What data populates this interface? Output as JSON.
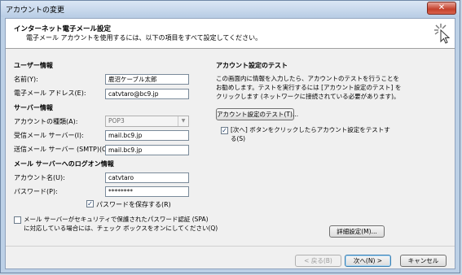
{
  "window": {
    "title": "アカウントの変更",
    "close_label": "✕"
  },
  "header": {
    "title": "インターネット電子メール設定",
    "subtitle": "電子メール アカウントを使用するには、以下の項目をすべて設定してください。"
  },
  "user_info": {
    "section": "ユーザー情報",
    "name_label": "名前(Y):",
    "name_value": "鹿沼ケーブル太郎",
    "email_label": "電子メール アドレス(E):",
    "email_value": "catvtaro@bc9.jp"
  },
  "server_info": {
    "section": "サーバー情報",
    "type_label": "アカウントの種類(A):",
    "type_value": "POP3",
    "incoming_label": "受信メール サーバー(I):",
    "incoming_value": "mail.bc9.jp",
    "outgoing_label": "送信メール サーバー (SMTP)(O):",
    "outgoing_value": "mail.bc9.jp"
  },
  "login_info": {
    "section": "メール サーバーへのログオン情報",
    "account_label": "アカウント名(U):",
    "account_value": "catvtaro",
    "password_label": "パスワード(P):",
    "password_value": "********",
    "remember_label": "パスワードを保存する(R)",
    "spa_line1": "メール サーバーがセキュリティで保護されたパスワード認証 (SPA)",
    "spa_line2": "に対応している場合には、チェック ボックスをオンにしてください(Q)"
  },
  "test": {
    "section": "アカウント設定のテスト",
    "desc1": "この画面内に情報を入力したら、アカウントのテストを行うことを",
    "desc2": "お勧めします。テストを実行するには [アカウント設定のテスト] を",
    "desc3": "クリックします (ネットワークに接続されている必要があります)。",
    "button": "アカウント設定のテスト(T)...",
    "next_check1": "[次へ] ボタンをクリックしたらアカウント設定をテストす",
    "next_check2": "る(S)"
  },
  "buttons": {
    "advanced": "詳細設定(M)...",
    "back": "< 戻る(B)",
    "next": "次へ(N) >",
    "cancel": "キャンセル"
  }
}
